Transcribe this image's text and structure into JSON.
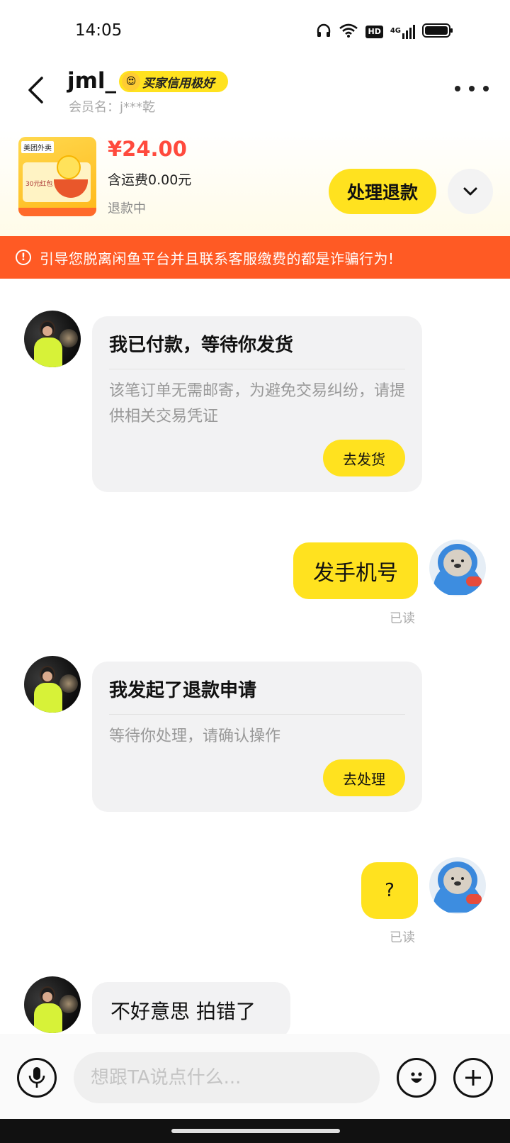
{
  "status_bar": {
    "time": "14:05",
    "icons": [
      "headphones-icon",
      "wifi-icon",
      "hd-icon",
      "signal-4g-icon",
      "battery-icon"
    ],
    "hd_label": "HD",
    "network_label": "4G"
  },
  "header": {
    "username": "jml_",
    "credit_badge": "买家信用极好",
    "member_name": "会员名：j***乾"
  },
  "product": {
    "thumb_brand": "美团外卖",
    "thumb_text": "30元红包",
    "price": "¥24.00",
    "shipping": "含运费0.00元",
    "status": "退款中",
    "refund_button": "处理退款"
  },
  "warning": {
    "text": "引导您脱离闲鱼平台并且联系客服缴费的都是诈骗行为!"
  },
  "messages": [
    {
      "side": "left",
      "type": "card",
      "title": "我已付款，等待你发货",
      "body": "该笔订单无需邮寄，为避免交易纠纷，请提供相关交易凭证",
      "button": "去发货"
    },
    {
      "side": "right",
      "type": "text",
      "text": "发手机号",
      "status": "已读"
    },
    {
      "side": "left",
      "type": "card",
      "title": "我发起了退款申请",
      "body": "等待你处理，请确认操作",
      "button": "去处理"
    },
    {
      "side": "right",
      "type": "text",
      "text": "?",
      "status": "已读"
    },
    {
      "side": "left",
      "type": "text",
      "text": "不好意思 拍错了"
    }
  ],
  "input_bar": {
    "placeholder": "想跟TA说点什么..."
  },
  "colors": {
    "accent_yellow": "#ffe21f",
    "price_red": "#ff4a3d",
    "warning_orange": "#ff5a24"
  }
}
